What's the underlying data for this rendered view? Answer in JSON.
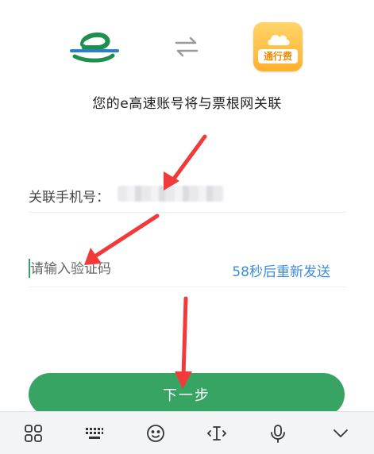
{
  "header": {
    "left_logo_icon": "e-expressway-logo-icon",
    "swap_icon": "swap-arrows-icon",
    "right_logo_icon": "tolls-app-logo-icon",
    "right_logo_label": "通行费"
  },
  "link_text": "您的e高速账号将与票根网关联",
  "phone_field": {
    "label": "关联手机号："
  },
  "code_field": {
    "placeholder": "请输入验证码",
    "resend_text": "58秒后重新发送"
  },
  "next_button": {
    "label": "下一步"
  },
  "keyboard_bar": {
    "icons": [
      "apps-grid-icon",
      "keyboard-icon",
      "emoji-icon",
      "text-cursor-icon",
      "microphone-icon",
      "chevron-down-icon"
    ]
  },
  "colors": {
    "accent_green": "#37a464",
    "link_blue": "#3c8dde",
    "annotation_red": "#f23a3a"
  }
}
